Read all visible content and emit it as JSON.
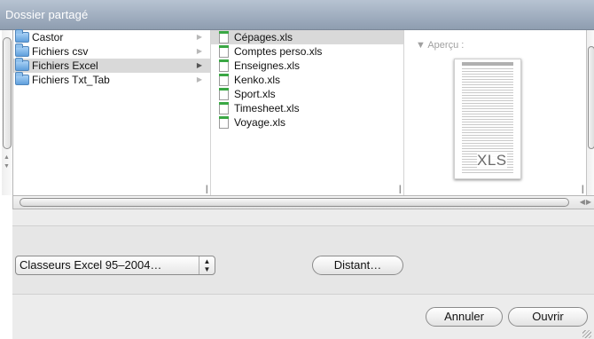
{
  "window": {
    "title": "Dossier partagé"
  },
  "browser": {
    "folders": [
      {
        "label": "Castor",
        "selected": false
      },
      {
        "label": "Fichiers csv",
        "selected": false
      },
      {
        "label": "Fichiers Excel",
        "selected": true
      },
      {
        "label": "Fichiers Txt_Tab",
        "selected": false
      }
    ],
    "files": [
      {
        "label": "Cépages.xls",
        "selected": true
      },
      {
        "label": "Comptes perso.xls",
        "selected": false
      },
      {
        "label": "Enseignes.xls",
        "selected": false
      },
      {
        "label": "Kenko.xls",
        "selected": false
      },
      {
        "label": "Sport.xls",
        "selected": false
      },
      {
        "label": "Timesheet.xls",
        "selected": false
      },
      {
        "label": "Voyage.xls",
        "selected": false
      }
    ],
    "preview": {
      "label": "Aperçu :",
      "thumbnail_tag": "XLS"
    }
  },
  "controls": {
    "format_popup": {
      "selected": "Classeurs Excel 95–2004…",
      "icon": "up-down-arrows-icon"
    },
    "distant_button": "Distant…",
    "cancel_button": "Annuler",
    "open_button": "Ouvrir"
  },
  "colors": {
    "header": "#9aa8ba",
    "selection": "#d9d9d9",
    "folder": "#7fb5ea",
    "file_tab": "#3aa744"
  }
}
